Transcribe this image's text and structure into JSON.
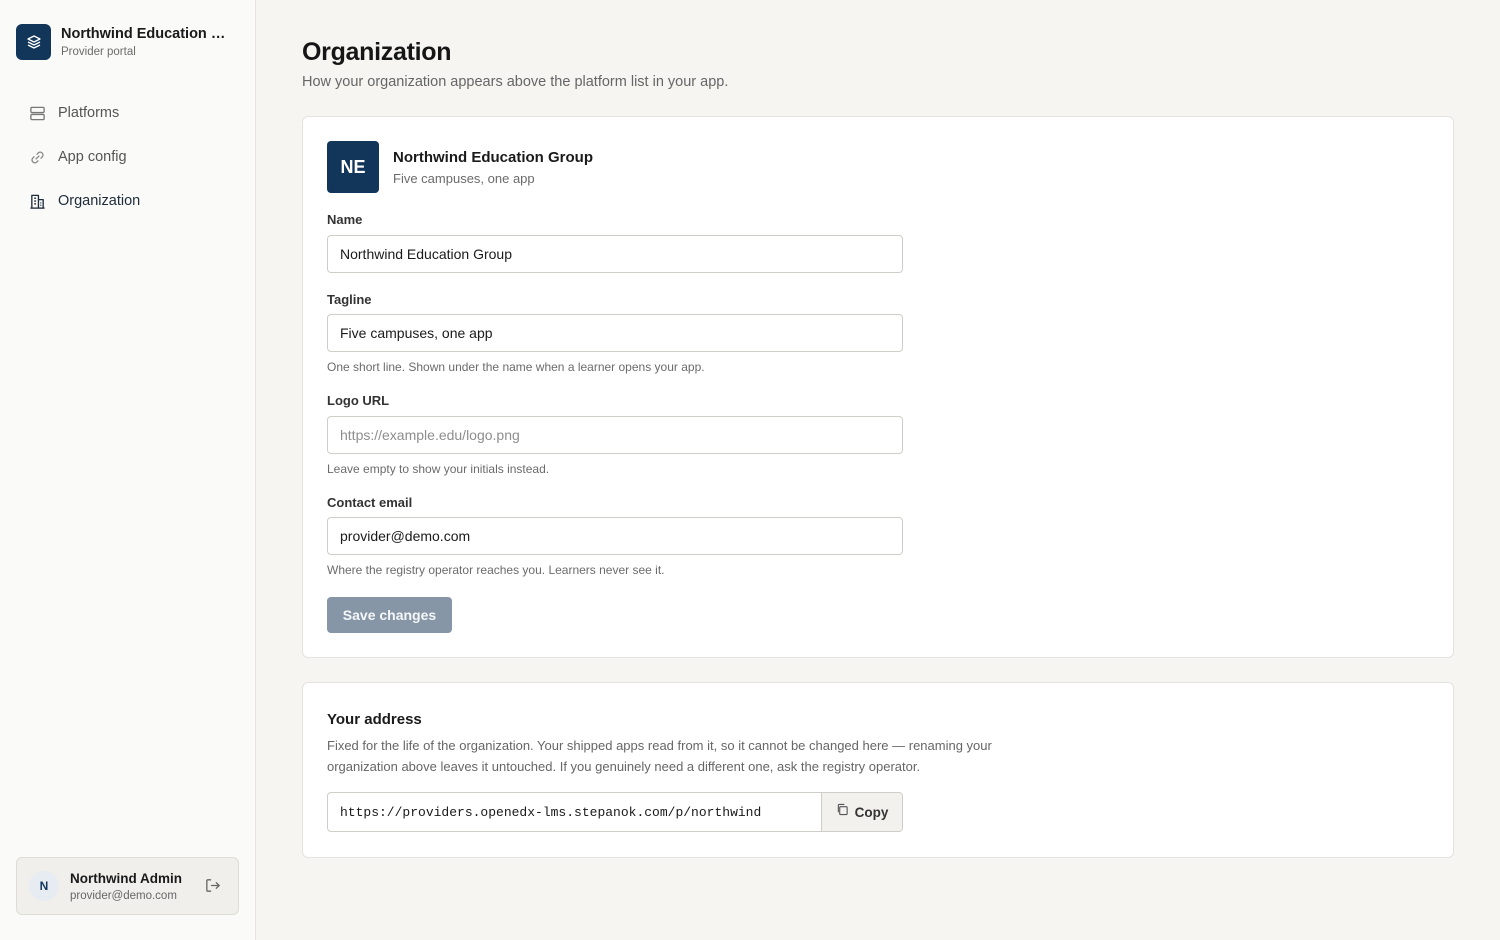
{
  "brand": {
    "name": "Northwind Education Group",
    "subtitle": "Provider portal",
    "logo_icon": "layers-icon"
  },
  "sidebar": {
    "items": [
      {
        "label": "Platforms",
        "icon": "server-icon",
        "active": false
      },
      {
        "label": "App config",
        "icon": "link-icon",
        "active": false
      },
      {
        "label": "Organization",
        "icon": "building-icon",
        "active": true
      }
    ]
  },
  "user": {
    "initial": "N",
    "name": "Northwind Admin",
    "email": "provider@demo.com",
    "logout_icon": "logout-icon"
  },
  "page": {
    "title": "Organization",
    "subtitle": "How your organization appears above the platform list in your app."
  },
  "org_card": {
    "avatar_initials": "NE",
    "preview_name": "Northwind Education Group",
    "preview_tagline": "Five campuses, one app",
    "fields": {
      "name": {
        "label": "Name",
        "value": "Northwind Education Group"
      },
      "tagline": {
        "label": "Tagline",
        "value": "Five campuses, one app",
        "help": "One short line. Shown under the name when a learner opens your app."
      },
      "logo_url": {
        "label": "Logo URL",
        "value": "",
        "placeholder": "https://example.edu/logo.png",
        "help": "Leave empty to show your initials instead."
      },
      "contact_email": {
        "label": "Contact email",
        "value": "provider@demo.com",
        "help": "Where the registry operator reaches you. Learners never see it."
      }
    },
    "save_label": "Save changes"
  },
  "address_card": {
    "title": "Your address",
    "description": "Fixed for the life of the organization. Your shipped apps read from it, so it cannot be changed here — renaming your organization above leaves it untouched. If you genuinely need a different one, ask the registry operator.",
    "url": "https://providers.openedx-lms.stepanok.com/p/northwind",
    "copy_label": "Copy",
    "copy_icon": "copy-icon"
  },
  "colors": {
    "brand": "#12365a",
    "page_bg": "#f6f5f2",
    "save_disabled": "#8796a6"
  }
}
